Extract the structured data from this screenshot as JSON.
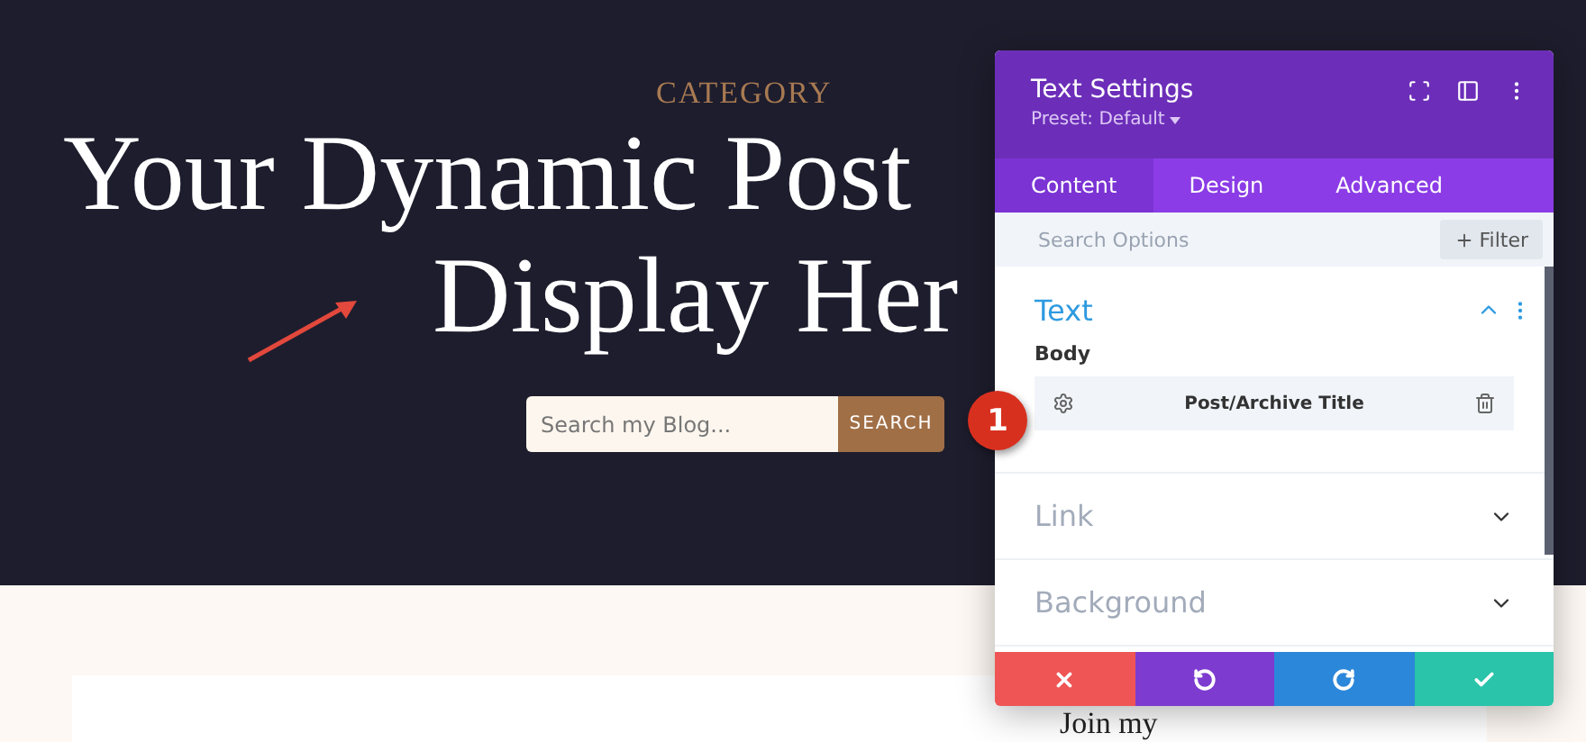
{
  "page": {
    "category": "CATEGORY",
    "title_lines": [
      "Your Dynamic Post",
      "Display Her"
    ],
    "search": {
      "placeholder": "Search my Blog...",
      "button": "SEARCH"
    },
    "card_heading": "Join my"
  },
  "panel": {
    "title": "Text Settings",
    "preset": "Preset: Default",
    "tabs": [
      {
        "label": "Content",
        "selected": true
      },
      {
        "label": "Design",
        "selected": false
      },
      {
        "label": "Advanced",
        "selected": false
      }
    ],
    "search": {
      "placeholder": "Search Options"
    },
    "filter_button": "Filter",
    "sections": [
      {
        "title": "Text",
        "expanded": true,
        "field_label": "Body",
        "dynamic_value": "Post/Archive Title"
      },
      {
        "title": "Link",
        "expanded": false
      },
      {
        "title": "Background",
        "expanded": false
      }
    ],
    "actions": [
      {
        "kind": "cancel"
      },
      {
        "kind": "undo"
      },
      {
        "kind": "redo"
      },
      {
        "kind": "save"
      }
    ]
  },
  "annotation": {
    "badge": "1"
  }
}
